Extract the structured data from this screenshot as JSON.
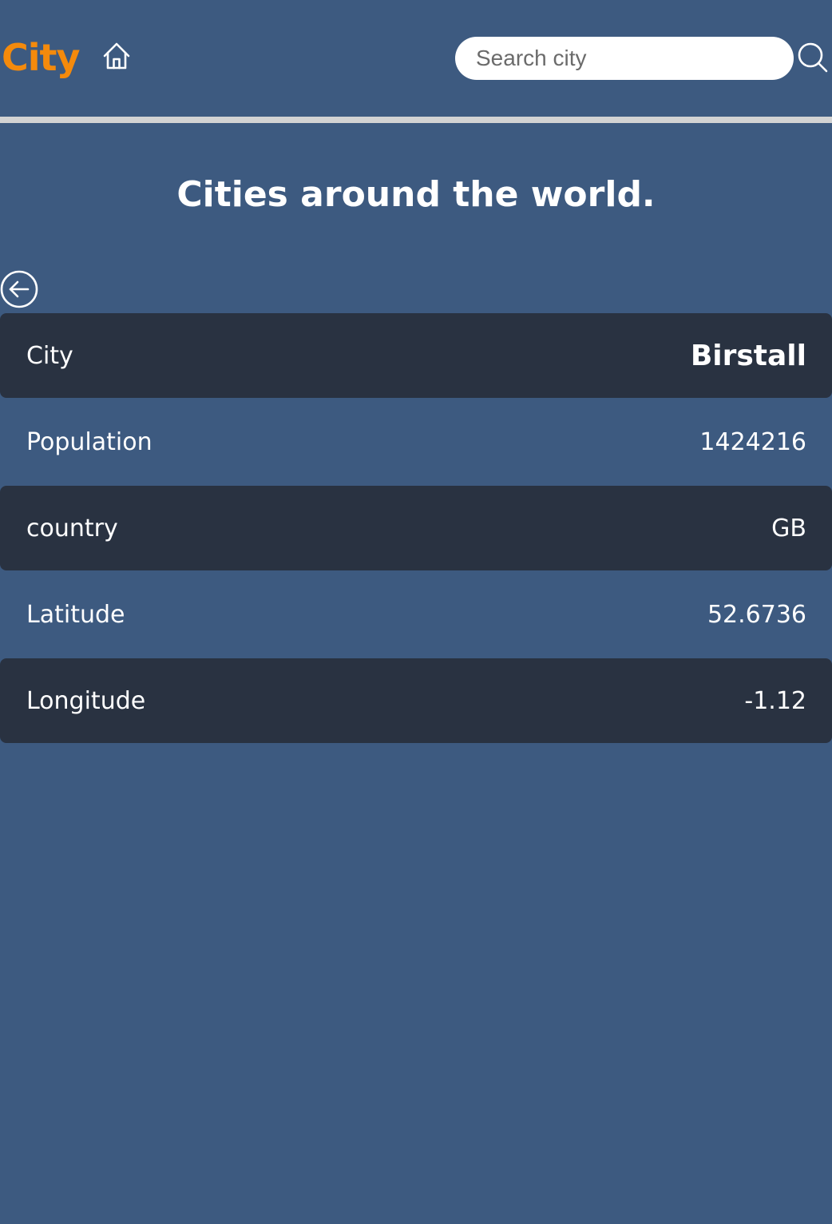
{
  "header": {
    "logo": "City",
    "home_icon": "home-icon",
    "search": {
      "placeholder": "Search city",
      "value": "",
      "icon": "search-icon"
    }
  },
  "main": {
    "title": "Cities around the world.",
    "back_icon": "arrow-left-circle-icon",
    "rows": [
      {
        "label": "City",
        "value": "Birstall"
      },
      {
        "label": "Population",
        "value": "1424216"
      },
      {
        "label": "country",
        "value": "GB"
      },
      {
        "label": "Latitude",
        "value": "52.6736"
      },
      {
        "label": "Longitude",
        "value": "-1.12"
      }
    ]
  },
  "colors": {
    "background": "#3d5a80",
    "row_dark": "#293241",
    "accent": "#f48a0c",
    "divider": "#d3d3d3"
  }
}
